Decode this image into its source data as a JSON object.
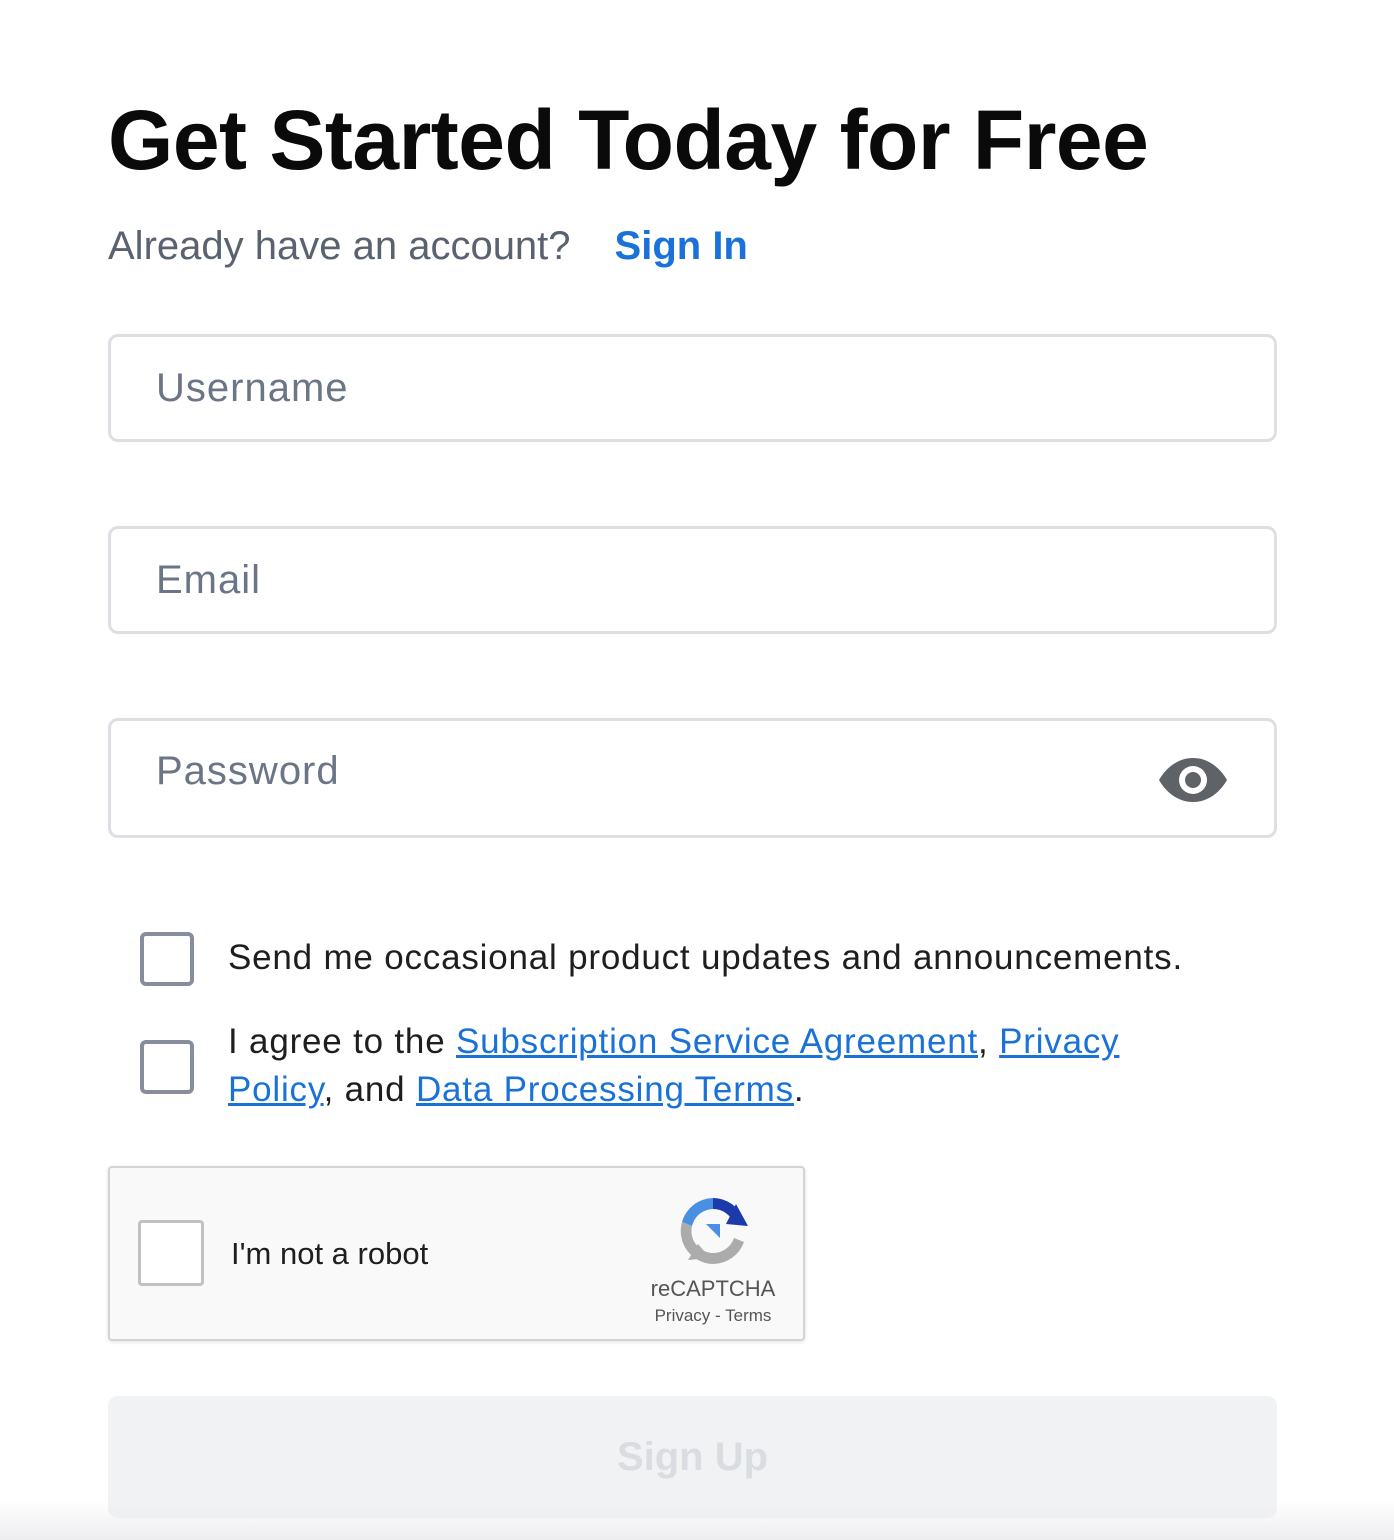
{
  "header": {
    "title": "Get Started Today for Free",
    "signin_prompt": "Already have an account?",
    "signin_link": "Sign In"
  },
  "form": {
    "username": {
      "placeholder": "Username",
      "value": ""
    },
    "email": {
      "placeholder": "Email",
      "value": ""
    },
    "password": {
      "placeholder": "Password",
      "value": "",
      "toggle_icon": "eye-icon"
    }
  },
  "checkboxes": {
    "updates": {
      "checked": false,
      "label": "Send me occasional product updates and announcements."
    },
    "agree": {
      "checked": false,
      "prefix": "I agree to the ",
      "link1": "Subscription Service Agreement",
      "sep1": ", ",
      "link2": "Privacy Policy",
      "sep2": ", and ",
      "link3": "Data Processing Terms",
      "suffix": "."
    }
  },
  "captcha": {
    "checked": false,
    "label": "I'm not a robot",
    "brand": "reCAPTCHA",
    "privacy": "Privacy",
    "separator": " - ",
    "terms": "Terms"
  },
  "submit": {
    "label": "Sign Up",
    "disabled": true
  },
  "colors": {
    "link": "#1a72d8",
    "title": "#0a0a0a",
    "muted_text": "#5a6270",
    "field_border": "#dcdfe3",
    "checkbox_border": "#868e9e",
    "button_disabled_bg": "#f1f2f4",
    "button_disabled_text": "#d9dce1"
  }
}
